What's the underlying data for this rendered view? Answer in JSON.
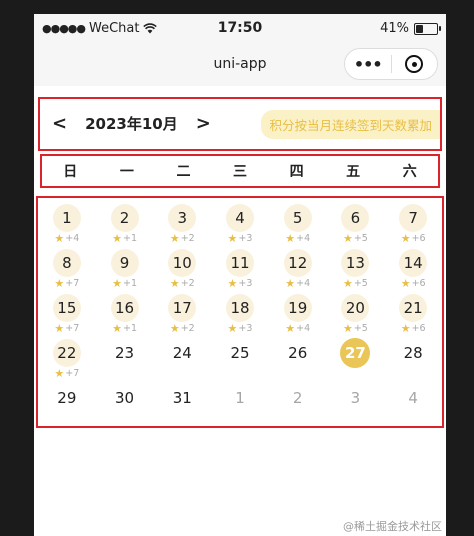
{
  "status_bar": {
    "carrier": "WeChat",
    "signal_dots": "●●●●●",
    "time": "17:50",
    "battery": "41%",
    "battery_level": 0.41
  },
  "navbar": {
    "title": "uni-app",
    "more_glyph": "•••"
  },
  "calendar": {
    "prev_arrow": "<",
    "next_arrow": ">",
    "month_label": "2023年10月",
    "hint": "积分按当月连续签到天数累加",
    "weekdays": [
      "日",
      "一",
      "二",
      "三",
      "四",
      "五",
      "六"
    ],
    "days": [
      {
        "num": "1",
        "pts": "+4"
      },
      {
        "num": "2",
        "pts": "+1"
      },
      {
        "num": "3",
        "pts": "+2"
      },
      {
        "num": "4",
        "pts": "+3"
      },
      {
        "num": "5",
        "pts": "+4"
      },
      {
        "num": "6",
        "pts": "+5"
      },
      {
        "num": "7",
        "pts": "+6"
      },
      {
        "num": "8",
        "pts": "+7"
      },
      {
        "num": "9",
        "pts": "+1"
      },
      {
        "num": "10",
        "pts": "+2"
      },
      {
        "num": "11",
        "pts": "+3"
      },
      {
        "num": "12",
        "pts": "+4"
      },
      {
        "num": "13",
        "pts": "+5"
      },
      {
        "num": "14",
        "pts": "+6"
      },
      {
        "num": "15",
        "pts": "+7"
      },
      {
        "num": "16",
        "pts": "+1"
      },
      {
        "num": "17",
        "pts": "+2"
      },
      {
        "num": "18",
        "pts": "+3"
      },
      {
        "num": "19",
        "pts": "+4"
      },
      {
        "num": "20",
        "pts": "+5"
      },
      {
        "num": "21",
        "pts": "+6"
      },
      {
        "num": "22",
        "pts": "+7"
      },
      {
        "num": "23"
      },
      {
        "num": "24"
      },
      {
        "num": "25"
      },
      {
        "num": "26"
      },
      {
        "num": "27",
        "today": true
      },
      {
        "num": "28"
      },
      {
        "num": "29"
      },
      {
        "num": "30"
      },
      {
        "num": "31"
      },
      {
        "num": "1",
        "other": true
      },
      {
        "num": "2",
        "other": true
      },
      {
        "num": "3",
        "other": true
      },
      {
        "num": "4",
        "other": true
      }
    ]
  },
  "watermark": "@稀土掘金技术社区",
  "colors": {
    "accent": "#e9c657",
    "hint_bg": "#fbf1c7",
    "hint_text": "#e8bf44",
    "highlight_box": "#d8242a"
  }
}
